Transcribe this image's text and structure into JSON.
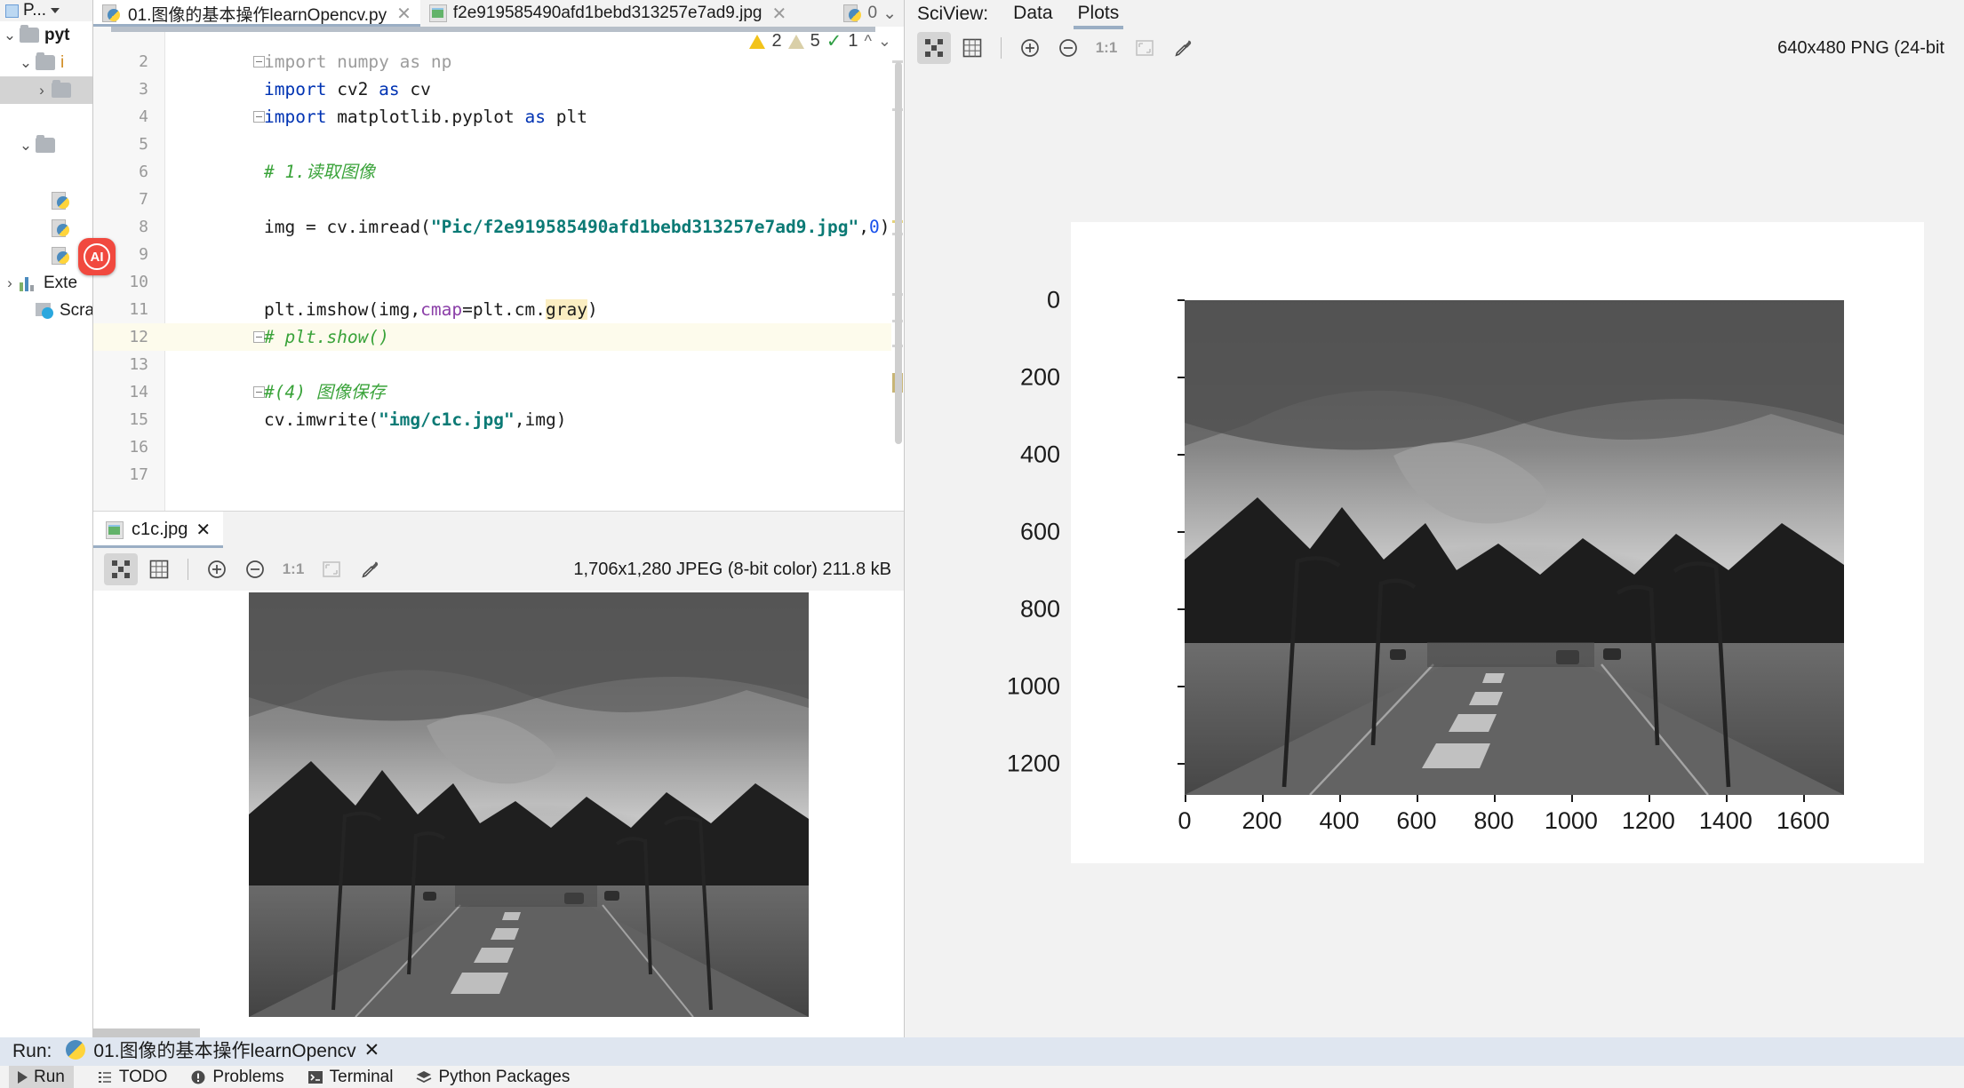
{
  "project": {
    "header_label": "P...",
    "items": [
      {
        "label": "pyt",
        "type": "folder",
        "bold": true,
        "expanded": true,
        "indent": 0
      },
      {
        "label": "i",
        "type": "folder",
        "bold": false,
        "expanded": true,
        "indent": 1,
        "orange": true
      },
      {
        "label": "",
        "type": "folder",
        "bold": false,
        "expanded": false,
        "indent": 2,
        "selected": true
      },
      {
        "label": "",
        "type": "blank",
        "indent": 2
      },
      {
        "label": "",
        "type": "folder",
        "bold": false,
        "expanded": true,
        "indent": 1,
        "orange": true
      },
      {
        "label": "",
        "type": "blank",
        "indent": 2
      },
      {
        "label": "",
        "type": "pyfile",
        "indent": 2
      },
      {
        "label": "",
        "type": "pyfile",
        "indent": 2
      },
      {
        "label": "",
        "type": "pyfile",
        "indent": 2
      },
      {
        "label": "Exte",
        "type": "library",
        "indent": 0,
        "expanded": false
      },
      {
        "label": "Scra",
        "type": "scratch",
        "indent": 1
      }
    ],
    "ai_badge": "AI"
  },
  "editor": {
    "tabs": [
      {
        "label": "01.图像的基本操作learnOpencv.py",
        "icon": "python-file-icon",
        "active": true,
        "closable": true
      },
      {
        "label": "f2e919585490afd1bebd313257e7ad9.jpg",
        "icon": "image-file-icon",
        "active": false,
        "closable": true
      }
    ],
    "run_config_count": "0",
    "inspections": {
      "warnings": "2",
      "weak_warnings": "5",
      "typos": "1"
    },
    "lines": [
      {
        "num": "2",
        "fold": true,
        "tokens": [
          {
            "t": "import numpy as np",
            "c": "gray"
          }
        ]
      },
      {
        "num": "3",
        "fold": false,
        "tokens": [
          {
            "t": "import",
            "c": "kw"
          },
          {
            "t": " cv2 ",
            "c": ""
          },
          {
            "t": "as",
            "c": "kw"
          },
          {
            "t": " cv",
            "c": ""
          }
        ]
      },
      {
        "num": "4",
        "fold": true,
        "tokens": [
          {
            "t": "import",
            "c": "kw"
          },
          {
            "t": " matplotlib.pyplot ",
            "c": ""
          },
          {
            "t": "as",
            "c": "kw"
          },
          {
            "t": " plt",
            "c": ""
          }
        ]
      },
      {
        "num": "5",
        "fold": false,
        "tokens": []
      },
      {
        "num": "6",
        "fold": false,
        "tokens": [
          {
            "t": "# 1.读取图像",
            "c": "cmt"
          }
        ]
      },
      {
        "num": "7",
        "fold": false,
        "tokens": []
      },
      {
        "num": "8",
        "fold": false,
        "tokens": [
          {
            "t": "img = cv.imread(",
            "c": ""
          },
          {
            "t": "\"Pic/f2e919585490afd1bebd313257e7ad9.jpg\"",
            "c": "str"
          },
          {
            "t": ",",
            "c": ""
          },
          {
            "t": "0",
            "c": "num-lit"
          },
          {
            "t": ")",
            "c": ""
          }
        ]
      },
      {
        "num": "9",
        "fold": false,
        "tokens": []
      },
      {
        "num": "10",
        "fold": false,
        "tokens": []
      },
      {
        "num": "11",
        "fold": false,
        "tokens": [
          {
            "t": "plt.imshow(img,",
            "c": ""
          },
          {
            "t": "cmap",
            "c": "param"
          },
          {
            "t": "=plt.cm.",
            "c": ""
          },
          {
            "t": "gray",
            "c": "hlt"
          },
          {
            "t": ")",
            "c": ""
          }
        ]
      },
      {
        "num": "12",
        "fold": true,
        "highlight": true,
        "tokens": [
          {
            "t": "# plt.show()",
            "c": "cmt"
          }
        ]
      },
      {
        "num": "13",
        "fold": false,
        "tokens": []
      },
      {
        "num": "14",
        "fold": true,
        "tokens": [
          {
            "t": "#(4) 图像保存",
            "c": "cmt"
          }
        ]
      },
      {
        "num": "15",
        "fold": false,
        "tokens": [
          {
            "t": "cv.imwrite(",
            "c": ""
          },
          {
            "t": "\"img/c1c.jpg\"",
            "c": "str"
          },
          {
            "t": ",img)",
            "c": ""
          }
        ]
      },
      {
        "num": "16",
        "fold": false,
        "tokens": []
      },
      {
        "num": "17",
        "fold": false,
        "tokens": []
      }
    ]
  },
  "image_viewer": {
    "tab_label": "c1c.jpg",
    "toolbar_buttons": [
      {
        "name": "transparency-grid-icon",
        "active": true
      },
      {
        "name": "pixel-grid-icon",
        "active": false
      },
      {
        "name": "zoom-in-icon",
        "active": false
      },
      {
        "name": "zoom-out-icon",
        "active": false
      },
      {
        "name": "actual-size-icon",
        "label": "1:1",
        "active": false
      },
      {
        "name": "fit-to-window-icon",
        "active": false
      },
      {
        "name": "color-picker-icon",
        "active": false
      }
    ],
    "meta": "1,706x1,280 JPEG (8-bit color) 211.8 kB"
  },
  "sciview": {
    "title": "SciView:",
    "tabs": [
      {
        "label": "Data",
        "active": false
      },
      {
        "label": "Plots",
        "active": true
      }
    ],
    "toolbar_buttons": [
      {
        "name": "transparency-grid-icon",
        "active": true
      },
      {
        "name": "pixel-grid-icon",
        "active": false
      },
      {
        "name": "zoom-in-icon",
        "active": false
      },
      {
        "name": "zoom-out-icon",
        "active": false
      },
      {
        "name": "actual-size-icon",
        "label": "1:1",
        "active": false
      },
      {
        "name": "fit-to-window-icon",
        "active": false
      },
      {
        "name": "color-picker-icon",
        "active": false
      }
    ],
    "meta": "640x480 PNG (24-bit"
  },
  "chart_data": {
    "type": "heatmap",
    "title": "",
    "xlabel": "",
    "ylabel": "",
    "description": "matplotlib imshow of a grayscale street photograph (1706x1280 px) rendered with cmap=plt.cm.gray",
    "xlim": [
      0,
      1706
    ],
    "ylim": [
      1280,
      0
    ],
    "xticks": [
      "0",
      "200",
      "400",
      "600",
      "800",
      "1000",
      "1200",
      "1400",
      "1600"
    ],
    "xtick_values": [
      0,
      200,
      400,
      600,
      800,
      1000,
      1200,
      1400,
      1600
    ],
    "yticks": [
      "0",
      "200",
      "400",
      "600",
      "800",
      "1000",
      "1200"
    ],
    "ytick_values": [
      0,
      200,
      400,
      600,
      800,
      1000,
      1200
    ],
    "grid": false,
    "legend": null,
    "colormap": "gray"
  },
  "run_panel": {
    "label": "Run:",
    "tab_label": "01.图像的基本操作learnOpencv"
  },
  "status_bar": {
    "items": [
      {
        "label": "Run",
        "icon": "play-icon",
        "active": true
      },
      {
        "label": "TODO",
        "icon": "todo-list-icon",
        "active": false
      },
      {
        "label": "Problems",
        "icon": "problems-icon",
        "active": false
      },
      {
        "label": "Terminal",
        "icon": "terminal-icon",
        "active": false
      },
      {
        "label": "Python Packages",
        "icon": "packages-icon",
        "active": false
      }
    ]
  },
  "colors": {
    "accent": "#3574f0",
    "tab_underline": "#9aaec4",
    "keyword": "#0033b3",
    "string": "#0b7a75",
    "comment": "#3aa33a",
    "warning": "#f2c31a",
    "ai_badge": "#f1493f"
  }
}
